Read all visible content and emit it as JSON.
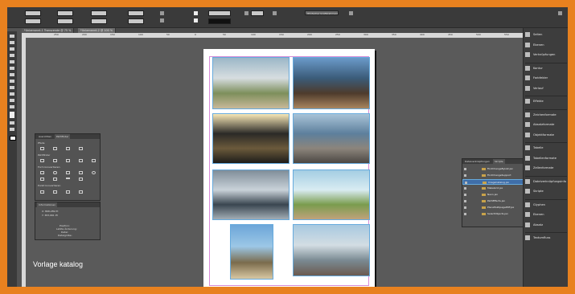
{
  "document_tabs": [
    "*Unbenannt-1 Transcende @ 75 %",
    "*Unbenannt-2 @ 100 %"
  ],
  "ruler_labels": [
    "250",
    "200",
    "150",
    "100",
    "50",
    "0",
    "50",
    "100",
    "150",
    "200",
    "250",
    "300",
    "350",
    "400",
    "450",
    "500",
    "550",
    "600"
  ],
  "control_bar": {
    "style_dropdown": "[Einfacher Grafikrahmen]",
    "stroke_weight": "0 Pt",
    "zoom": "100 %"
  },
  "photos": [
    {
      "name": "boardwalk-dunes-photo",
      "colors": [
        "#9bb7c7",
        "#d7dde0",
        "#7d8f5c",
        "#c9b99a"
      ]
    },
    {
      "name": "rocky-coast-photo",
      "colors": [
        "#6b9ac9",
        "#3b5c7a",
        "#4d3b2c",
        "#a9865f"
      ]
    },
    {
      "name": "sunset-silhouette-photo",
      "colors": [
        "#f7e7b7",
        "#2b2a27",
        "#6b5a3b",
        "#1d1c1a"
      ]
    },
    {
      "name": "pebble-beach-photo",
      "colors": [
        "#a9c4d8",
        "#5d7f9c",
        "#8c857c",
        "#4b4743"
      ]
    },
    {
      "name": "seagulls-photo",
      "colors": [
        "#7f8d99",
        "#c9d2d9",
        "#3a4650",
        "#a2adb5"
      ]
    },
    {
      "name": "cliff-lighthouse-photo",
      "colors": [
        "#a4cde3",
        "#d9ecf2",
        "#7a9c4e",
        "#c0a27b"
      ]
    },
    {
      "name": "coastal-bay-photo",
      "colors": [
        "#6ca6d9",
        "#9cc7e6",
        "#7a6b4c",
        "#d8c7a2"
      ]
    },
    {
      "name": "pool-ladder-photo",
      "colors": [
        "#a8c9e0",
        "#d3dde3",
        "#7a8a92",
        "#6b5a50"
      ]
    }
  ],
  "caption": "Vorlage katalog",
  "pathfinder_panel": {
    "tabs": [
      "Ausrichten",
      "Pathfinder"
    ],
    "sections": [
      "Pfade",
      "Pathfinder",
      "Form konvertieren",
      "Punkt konvertieren"
    ]
  },
  "info_panel": {
    "title": "Informationen",
    "values": [
      "X: 868,289 Pt",
      "Y: 383,661 Pt"
    ],
    "footer": [
      "Position:",
      "Letzte Änderung:",
      "Datei:",
      "Dateigröße:"
    ]
  },
  "layers_panel": {
    "tabs": [
      "Dateiverknüpfungen",
      "Skripte"
    ],
    "items": [
      {
        "label": "FindChangeByList.jsx",
        "selected": false
      },
      {
        "label": "FindChangeSupport",
        "selected": false
      },
      {
        "label": "ImageCatalog.jsx",
        "selected": true
      },
      {
        "label": "MakeGrid.jsx",
        "selected": false
      },
      {
        "label": "Neon.jsx",
        "selected": false
      },
      {
        "label": "PathEffects.jsx",
        "selected": false
      },
      {
        "label": "PlaceMultipagePDF.jsx",
        "selected": false
      },
      {
        "label": "SelectObjects.jsx",
        "selected": false
      }
    ]
  },
  "dock": [
    {
      "label": "Seiten",
      "icon": "pages-icon"
    },
    {
      "label": "Ebenen",
      "icon": "layers-icon"
    },
    {
      "label": "Verknüpfungen",
      "icon": "links-icon"
    },
    {
      "label": "Kontur",
      "icon": "stroke-icon"
    },
    {
      "label": "Farbfelder",
      "icon": "swatches-icon"
    },
    {
      "label": "Verlauf",
      "icon": "gradient-icon"
    },
    {
      "label": "Effekte",
      "icon": "effects-icon"
    },
    {
      "label": "Zeichenformate",
      "icon": "character-styles-icon"
    },
    {
      "label": "Absatzformate",
      "icon": "paragraph-styles-icon"
    },
    {
      "label": "Objektformate",
      "icon": "object-styles-icon"
    },
    {
      "label": "Tabelle",
      "icon": "table-icon"
    },
    {
      "label": "Tabellenformate",
      "icon": "table-styles-icon"
    },
    {
      "label": "Zellenformate",
      "icon": "cell-styles-icon"
    },
    {
      "label": "Dateiverknüpfungsinfo",
      "icon": "link-info-icon"
    },
    {
      "label": "Skripte",
      "icon": "scripts-icon"
    },
    {
      "label": "Glyphen",
      "icon": "glyphs-icon"
    },
    {
      "label": "Ebenen",
      "icon": "layers-icon"
    },
    {
      "label": "Absatz",
      "icon": "paragraph-icon"
    },
    {
      "label": "Textumfluss",
      "icon": "text-wrap-icon"
    }
  ]
}
